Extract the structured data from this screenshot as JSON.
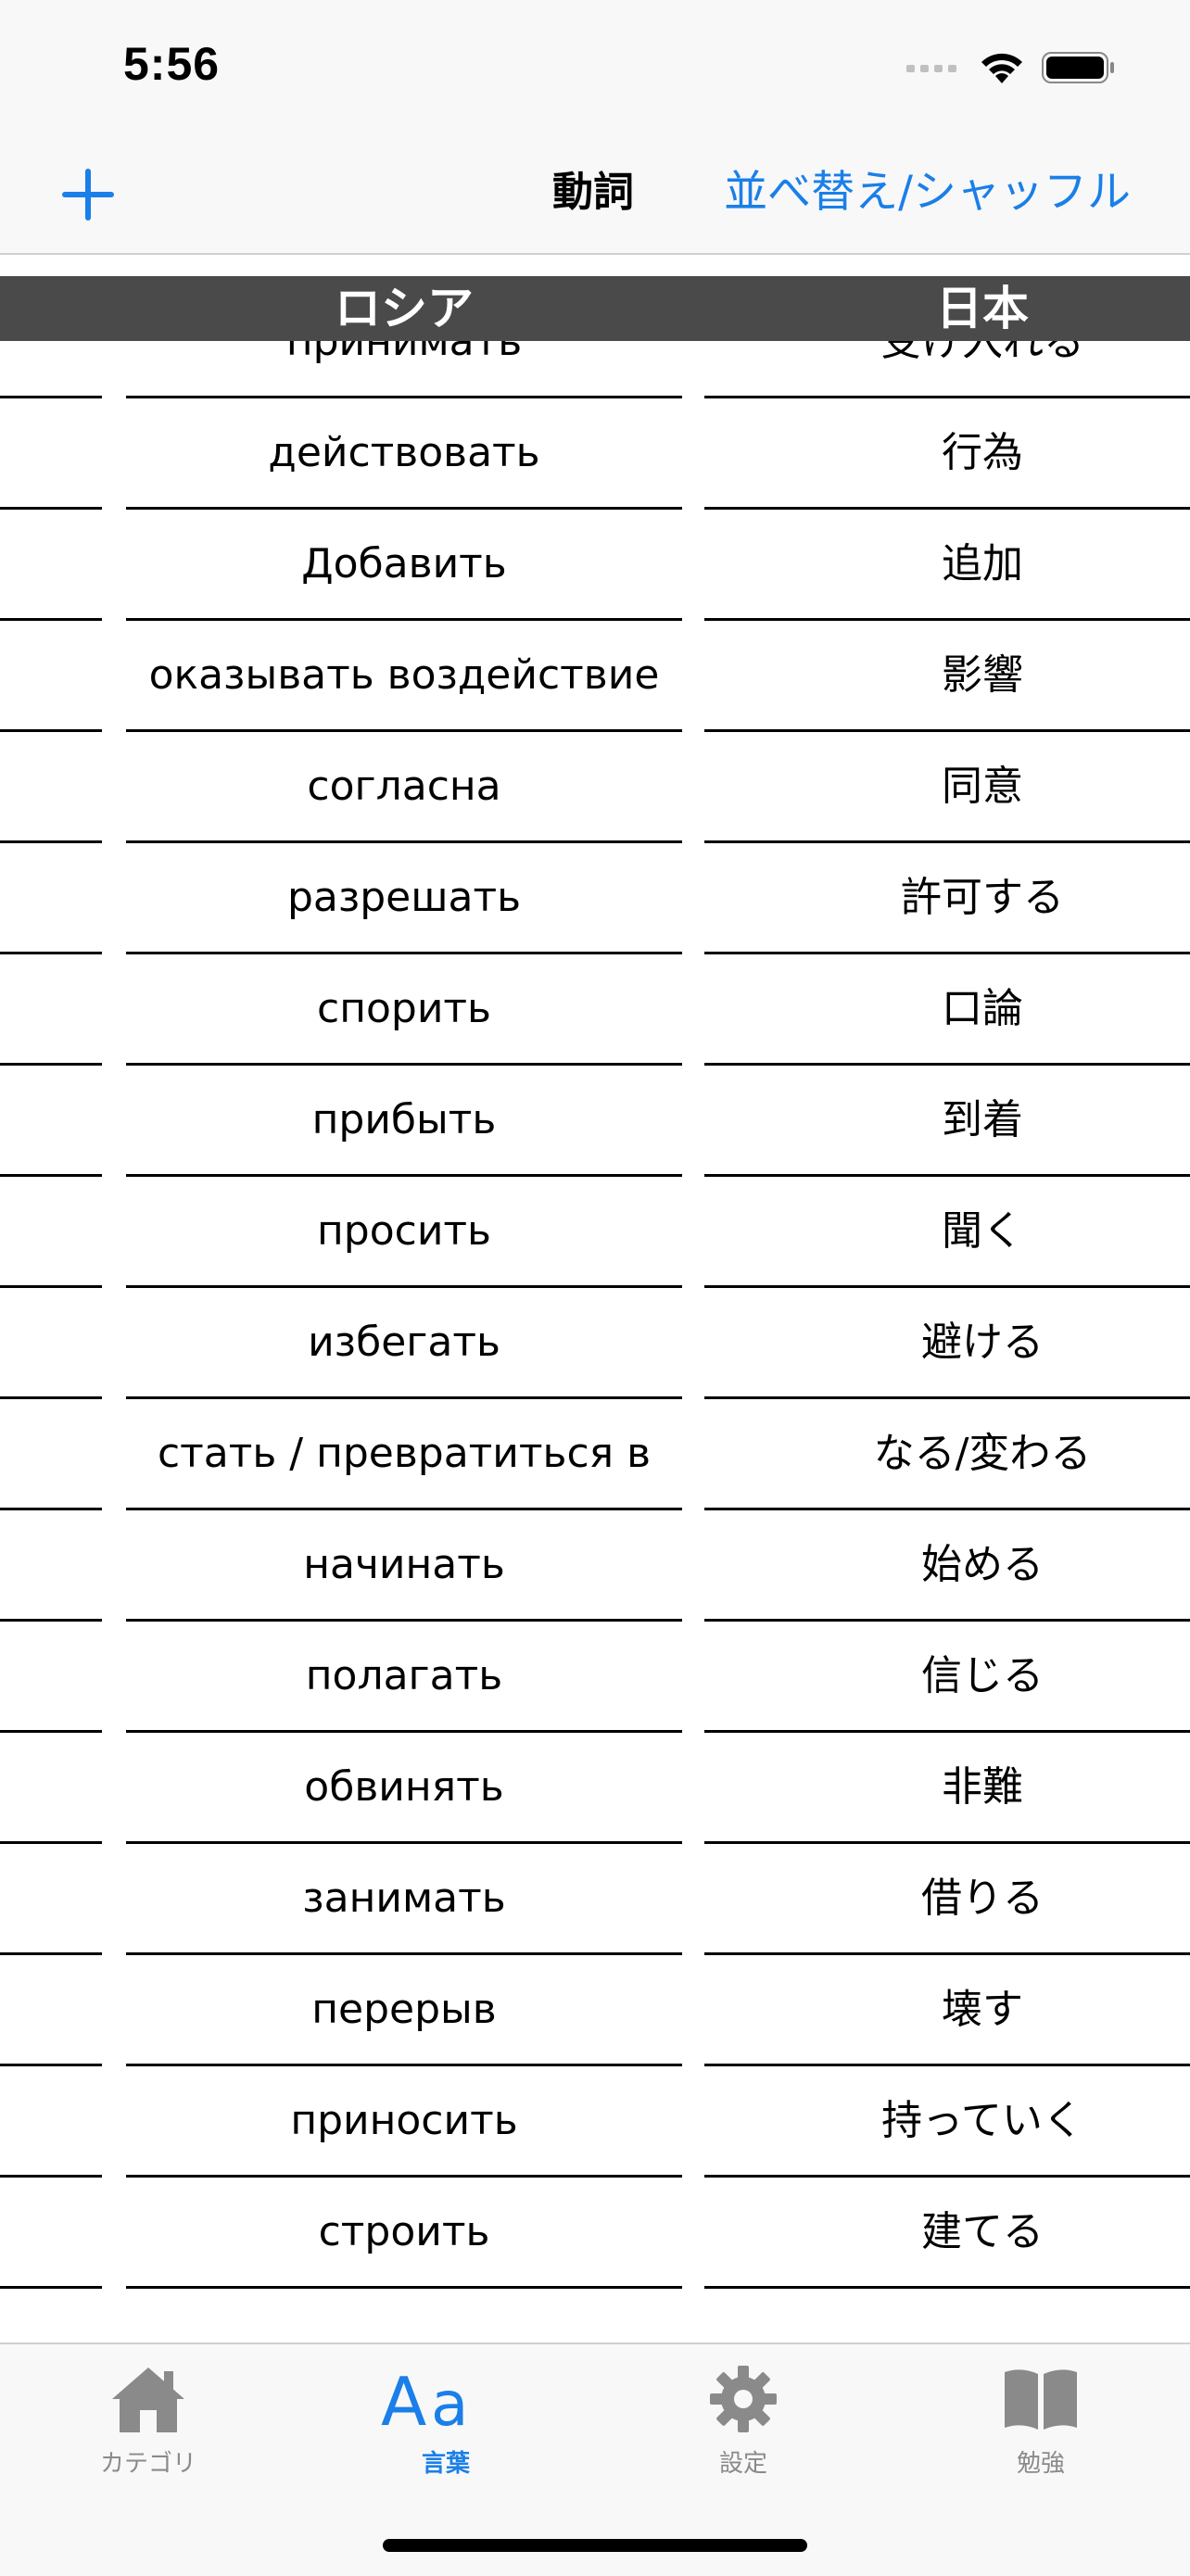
{
  "status_bar": {
    "time": "5:56"
  },
  "nav": {
    "title": "動詞",
    "sort_shuffle_label": "並べ替え/シャッフル"
  },
  "table": {
    "headers": {
      "russian": "ロシア",
      "japanese": "日本"
    },
    "rows": [
      {
        "russian": "принимать",
        "japanese": "受け入れる"
      },
      {
        "russian": "действовать",
        "japanese": "行為"
      },
      {
        "russian": "Добавить",
        "japanese": "追加"
      },
      {
        "russian": "оказывать воздействие",
        "japanese": "影響"
      },
      {
        "russian": "согласна",
        "japanese": "同意"
      },
      {
        "russian": "разрешать",
        "japanese": "許可する"
      },
      {
        "russian": "спорить",
        "japanese": "口論"
      },
      {
        "russian": "прибыть",
        "japanese": "到着"
      },
      {
        "russian": "просить",
        "japanese": "聞く"
      },
      {
        "russian": "избегать",
        "japanese": "避ける"
      },
      {
        "russian": "стать / превратиться в",
        "japanese": "なる/変わる"
      },
      {
        "russian": "начинать",
        "japanese": "始める"
      },
      {
        "russian": "полагать",
        "japanese": "信じる"
      },
      {
        "russian": "обвинять",
        "japanese": "非難"
      },
      {
        "russian": "занимать",
        "japanese": "借りる"
      },
      {
        "russian": "перерыв",
        "japanese": "壊す"
      },
      {
        "russian": "приносить",
        "japanese": "持っていく"
      },
      {
        "russian": "строить",
        "japanese": "建てる"
      },
      {
        "russian": "",
        "japanese": ""
      }
    ]
  },
  "tab_bar": {
    "tabs": [
      {
        "label": "カテゴリ",
        "icon": "house-icon",
        "active": false
      },
      {
        "label": "言葉",
        "icon": "text-format-icon",
        "active": true
      },
      {
        "label": "設定",
        "icon": "gear-icon",
        "active": false
      },
      {
        "label": "勉強",
        "icon": "book-icon",
        "active": false
      }
    ]
  },
  "colors": {
    "accent": "#1a7fe8",
    "header_bg": "#4a4a4a",
    "inactive_tab": "#8a8a8a"
  }
}
